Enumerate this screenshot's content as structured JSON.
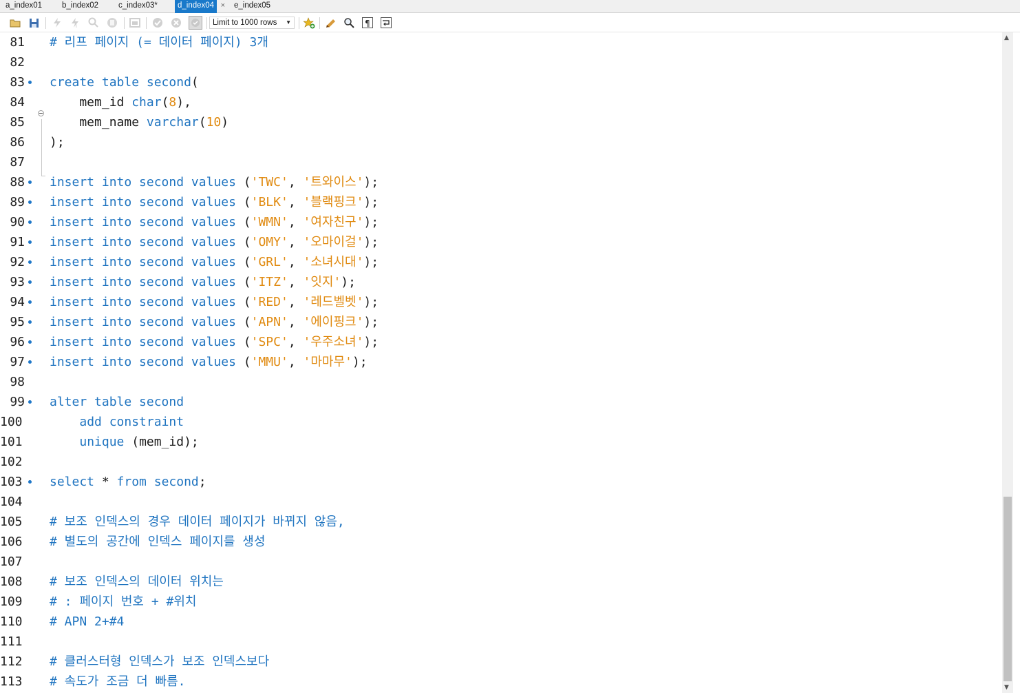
{
  "tabs": [
    {
      "label": "a_index01",
      "active": false
    },
    {
      "label": "b_index02",
      "active": false
    },
    {
      "label": "c_index03*",
      "active": false
    },
    {
      "label": "d_index04",
      "active": true
    },
    {
      "label": "e_index05",
      "active": false
    }
  ],
  "tab_close_glyph": "×",
  "toolbar": {
    "limit_select": "Limit to 1000 rows",
    "icons": [
      "open-folder-icon",
      "save-icon",
      "execute-icon",
      "execute-current-icon",
      "explain-icon",
      "stop-icon",
      "toggle-output-icon",
      "commit-icon",
      "rollback-icon",
      "autocommit-icon",
      "add-snippet-icon",
      "beautify-icon",
      "find-icon",
      "invisible-chars-icon",
      "wrap-icon"
    ]
  },
  "editor": {
    "lines": [
      {
        "n": "81",
        "dot": false,
        "html": "<span class='cmt'># 리프 페이지 (= 데이터 페이지) 3개</span>"
      },
      {
        "n": "82",
        "dot": false,
        "html": ""
      },
      {
        "n": "83",
        "dot": true,
        "html": "<span class='kw'>create table second</span>("
      },
      {
        "n": "84",
        "dot": false,
        "html": "    mem_id <span class='kw'>char</span>(<span class='num'>8</span>),"
      },
      {
        "n": "85",
        "dot": false,
        "html": "    mem_name <span class='kw'>varchar</span>(<span class='num'>10</span>)"
      },
      {
        "n": "86",
        "dot": false,
        "html": ");"
      },
      {
        "n": "87",
        "dot": false,
        "html": ""
      },
      {
        "n": "88",
        "dot": true,
        "html": "<span class='kw'>insert into second values</span> (<span class='str'>'TWC'</span>, <span class='str'>'트와이스'</span>);"
      },
      {
        "n": "89",
        "dot": true,
        "html": "<span class='kw'>insert into second values</span> (<span class='str'>'BLK'</span>, <span class='str'>'블랙핑크'</span>);"
      },
      {
        "n": "90",
        "dot": true,
        "html": "<span class='kw'>insert into second values</span> (<span class='str'>'WMN'</span>, <span class='str'>'여자친구'</span>);"
      },
      {
        "n": "91",
        "dot": true,
        "html": "<span class='kw'>insert into second values</span> (<span class='str'>'OMY'</span>, <span class='str'>'오마이걸'</span>);"
      },
      {
        "n": "92",
        "dot": true,
        "html": "<span class='kw'>insert into second values</span> (<span class='str'>'GRL'</span>, <span class='str'>'소녀시대'</span>);"
      },
      {
        "n": "93",
        "dot": true,
        "html": "<span class='kw'>insert into second values</span> (<span class='str'>'ITZ'</span>, <span class='str'>'잇지'</span>);"
      },
      {
        "n": "94",
        "dot": true,
        "html": "<span class='kw'>insert into second values</span> (<span class='str'>'RED'</span>, <span class='str'>'레드벨벳'</span>);"
      },
      {
        "n": "95",
        "dot": true,
        "html": "<span class='kw'>insert into second values</span> (<span class='str'>'APN'</span>, <span class='str'>'에이핑크'</span>);"
      },
      {
        "n": "96",
        "dot": true,
        "html": "<span class='kw'>insert into second values</span> (<span class='str'>'SPC'</span>, <span class='str'>'우주소녀'</span>);"
      },
      {
        "n": "97",
        "dot": true,
        "html": "<span class='kw'>insert into second values</span> (<span class='str'>'MMU'</span>, <span class='str'>'마마무'</span>);"
      },
      {
        "n": "98",
        "dot": false,
        "html": ""
      },
      {
        "n": "99",
        "dot": true,
        "html": "<span class='kw'>alter table second</span>"
      },
      {
        "n": "100",
        "dot": false,
        "html": "    <span class='kw'>add constraint</span>"
      },
      {
        "n": "101",
        "dot": false,
        "html": "    <span class='kw'>unique</span> (mem_id);"
      },
      {
        "n": "102",
        "dot": false,
        "html": ""
      },
      {
        "n": "103",
        "dot": true,
        "html": "<span class='kw'>select</span> * <span class='kw'>from second</span>;"
      },
      {
        "n": "104",
        "dot": false,
        "html": ""
      },
      {
        "n": "105",
        "dot": false,
        "html": "<span class='cmt'># 보조 인덱스의 경우 데이터 페이지가 바뀌지 않음,</span>"
      },
      {
        "n": "106",
        "dot": false,
        "html": "<span class='cmt'># 별도의 공간에 인덱스 페이지를 생성</span>"
      },
      {
        "n": "107",
        "dot": false,
        "html": ""
      },
      {
        "n": "108",
        "dot": false,
        "html": "<span class='cmt'># 보조 인덱스의 데이터 위치는</span>"
      },
      {
        "n": "109",
        "dot": false,
        "html": "<span class='cmt'># : 페이지 번호 + #위치</span>"
      },
      {
        "n": "110",
        "dot": false,
        "html": "<span class='cmt'># APN 2+#4</span>"
      },
      {
        "n": "111",
        "dot": false,
        "html": ""
      },
      {
        "n": "112",
        "dot": false,
        "html": "<span class='cmt'># 클러스터형 인덱스가 보조 인덱스보다</span>"
      },
      {
        "n": "113",
        "dot": false,
        "html": "<span class='cmt'># 속도가 조금 더 빠름.</span>"
      }
    ]
  },
  "colors": {
    "keyword": "#1f74c0",
    "string": "#e08a10",
    "active_tab": "#1979ca"
  }
}
